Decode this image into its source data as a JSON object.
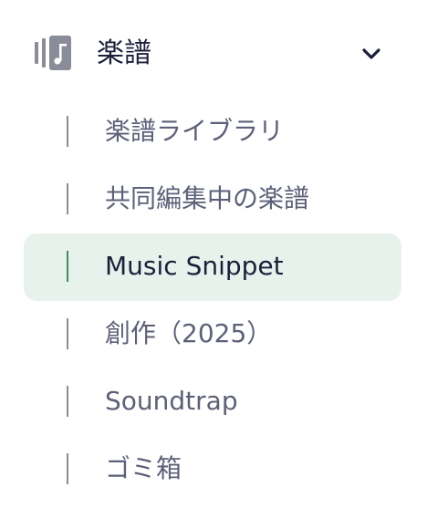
{
  "section": {
    "title": "楽譜",
    "icon": "music-score-icon",
    "expand_icon": "chevron-down-icon",
    "expanded": true
  },
  "nav": {
    "items": [
      {
        "label": "楽譜ライブラリ",
        "active": false
      },
      {
        "label": "共同編集中の楽譜",
        "active": false
      },
      {
        "label": "Music Snippet",
        "active": true
      },
      {
        "label": "創作（2025）",
        "active": false
      },
      {
        "label": "Soundtrap",
        "active": false
      },
      {
        "label": "ゴミ箱",
        "active": false
      }
    ]
  },
  "colors": {
    "title_text": "#1c1f3a",
    "item_text": "#5d6178",
    "active_background": "#e8f2ec",
    "active_bar": "#3f8c5d",
    "inactive_bar": "#8a8d99",
    "icon": "#8a8d99"
  }
}
